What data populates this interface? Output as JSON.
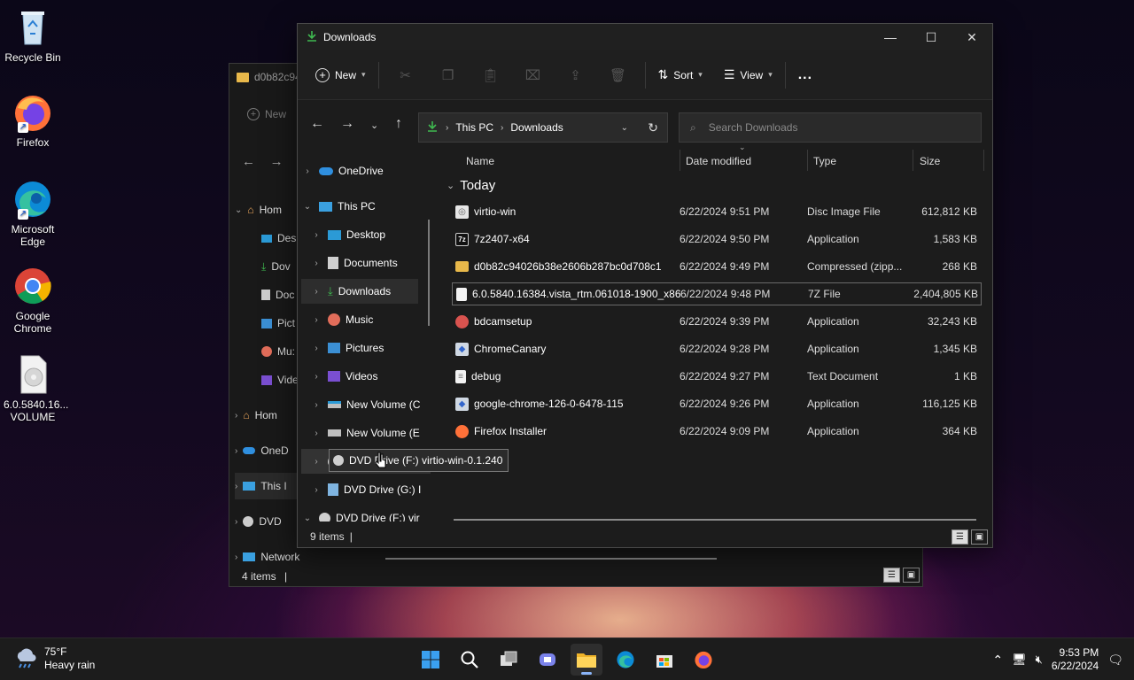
{
  "desktop": {
    "icons": [
      {
        "label": "Recycle Bin"
      },
      {
        "label": "Firefox"
      },
      {
        "label": "Microsoft Edge"
      },
      {
        "label": "Google Chrome"
      },
      {
        "label": "6.0.5840.16... VOLUME"
      }
    ]
  },
  "back_window": {
    "title": "d0b82c94",
    "new_label": "New",
    "tree": [
      "Hom",
      "Des",
      "Dov",
      "Doc",
      "Pict",
      "Mu:",
      "Vide",
      "Hom",
      "OneD",
      "This I",
      "DVD",
      "Network"
    ],
    "status": "4 items"
  },
  "window": {
    "title": "Downloads",
    "toolbar": {
      "new_label": "New",
      "sort_label": "Sort",
      "view_label": "View",
      "more_label": "..."
    },
    "address": {
      "crumbs": [
        "This PC",
        "Downloads"
      ]
    },
    "search": {
      "placeholder": "Search Downloads"
    },
    "sidebar": [
      {
        "label": "OneDrive",
        "icon": "onedrive-icon"
      },
      {
        "label": "This PC",
        "icon": "pc-icon"
      },
      {
        "label": "Desktop",
        "icon": "desktop-icon"
      },
      {
        "label": "Documents",
        "icon": "documents-icon"
      },
      {
        "label": "Downloads",
        "icon": "download-icon"
      },
      {
        "label": "Music",
        "icon": "music-icon"
      },
      {
        "label": "Pictures",
        "icon": "pictures-icon"
      },
      {
        "label": "Videos",
        "icon": "videos-icon"
      },
      {
        "label": "New Volume (C",
        "icon": "drive-icon"
      },
      {
        "label": "New Volume (E",
        "icon": "drive-icon"
      },
      {
        "label": "DVD Drive (F:) virtio-win-0.1.240",
        "icon": "dvd-icon"
      },
      {
        "label": "DVD Drive (G:) I",
        "icon": "dvd-icon"
      },
      {
        "label": "DVD Drive (F:) vir",
        "icon": "dvd-icon"
      }
    ],
    "columns": {
      "name": "Name",
      "date": "Date modified",
      "type": "Type",
      "size": "Size"
    },
    "group": "Today",
    "files": [
      {
        "name": "virtio-win",
        "date": "6/22/2024 9:51 PM",
        "type": "Disc Image File",
        "size": "612,812 KB",
        "icon": "disc-image-icon"
      },
      {
        "name": "7z2407-x64",
        "date": "6/22/2024 9:50 PM",
        "type": "Application",
        "size": "1,583 KB",
        "icon": "7zip-icon"
      },
      {
        "name": "d0b82c94026b38e2606b287bc0d708c1",
        "date": "6/22/2024 9:49 PM",
        "type": "Compressed (zipp...",
        "size": "268 KB",
        "icon": "zip-folder-icon"
      },
      {
        "name": "6.0.5840.16384.vista_rtm.061018-1900_x86...",
        "date": "6/22/2024 9:48 PM",
        "type": "7Z File",
        "size": "2,404,805 KB",
        "icon": "file-icon"
      },
      {
        "name": "bdcamsetup",
        "date": "6/22/2024 9:39 PM",
        "type": "Application",
        "size": "32,243 KB",
        "icon": "bandicam-icon"
      },
      {
        "name": "ChromeCanary",
        "date": "6/22/2024 9:28 PM",
        "type": "Application",
        "size": "1,345 KB",
        "icon": "installer-icon"
      },
      {
        "name": "debug",
        "date": "6/22/2024 9:27 PM",
        "type": "Text Document",
        "size": "1 KB",
        "icon": "text-file-icon"
      },
      {
        "name": "google-chrome-126-0-6478-115",
        "date": "6/22/2024 9:26 PM",
        "type": "Application",
        "size": "116,125 KB",
        "icon": "installer-icon"
      },
      {
        "name": "Firefox Installer",
        "date": "6/22/2024 9:09 PM",
        "type": "Application",
        "size": "364 KB",
        "icon": "firefox-icon"
      }
    ],
    "status": "9 items",
    "tooltip": "DVD Drive (F:) virtio-win-0.1.240"
  },
  "taskbar": {
    "temp": "75°F",
    "condition": "Heavy rain",
    "time": "9:53 PM",
    "date": "6/22/2024"
  }
}
